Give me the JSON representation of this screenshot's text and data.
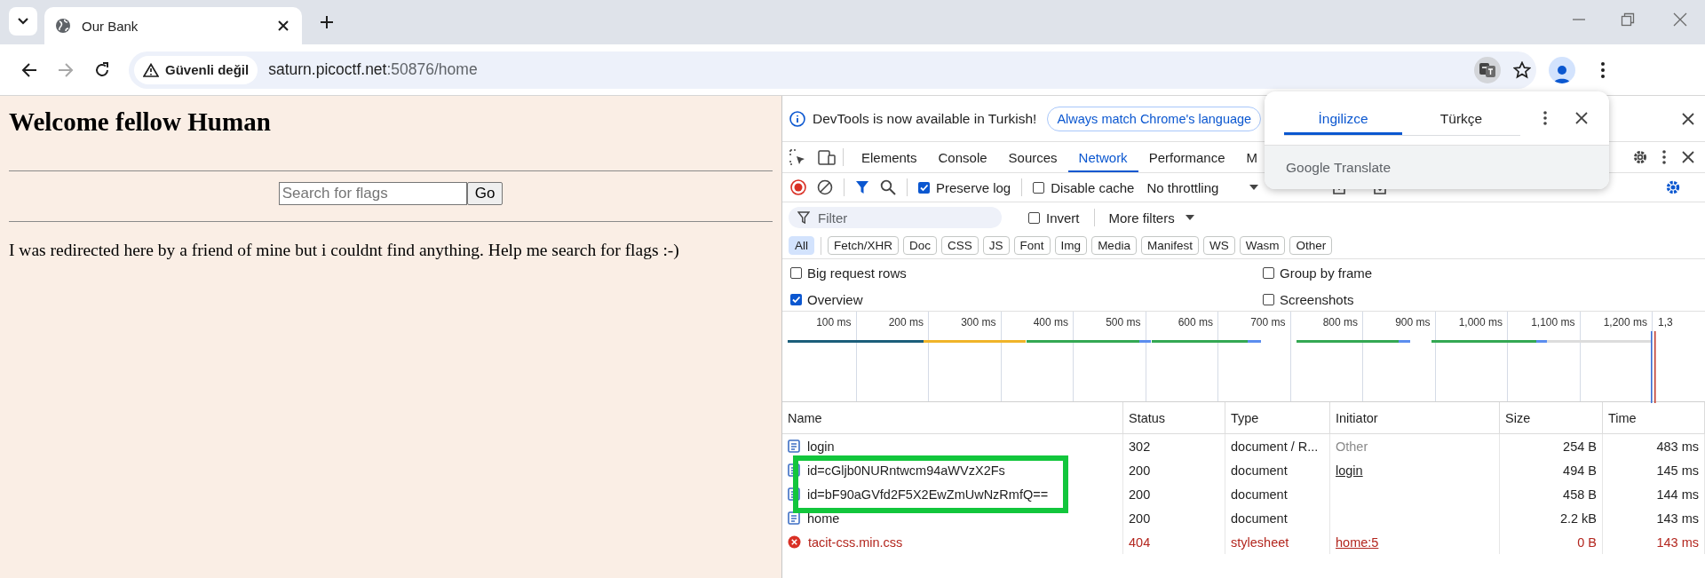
{
  "browser": {
    "tabs": [
      {
        "title": "Our Bank",
        "selected": true
      }
    ],
    "security_label": "Güvenli değil",
    "url_host": "saturn.picoctf.net",
    "url_path": ":50876/home"
  },
  "page": {
    "heading": "Welcome fellow Human",
    "search": {
      "placeholder": "Search for flags"
    },
    "go_button": "Go",
    "paragraph": "I was redirected here by a friend of mine but i couldnt find anything. Help me search for flags :-)"
  },
  "devtools": {
    "notice": {
      "text": "DevTools is now available in Turkish!",
      "button": "Always match Chrome's language"
    },
    "panel_tabs": [
      {
        "label": "Elements",
        "selected": false
      },
      {
        "label": "Console",
        "selected": false
      },
      {
        "label": "Sources",
        "selected": false
      },
      {
        "label": "Network",
        "selected": true
      },
      {
        "label": "Performance",
        "selected": false
      },
      {
        "label": "M",
        "selected": false
      }
    ],
    "toolbar": {
      "preserve_log": {
        "label": "Preserve log",
        "checked": true
      },
      "disable_cache": {
        "label": "Disable cache",
        "checked": false
      },
      "throttling": "No throttling"
    },
    "filter": {
      "placeholder": "Filter"
    },
    "invert": {
      "label": "Invert",
      "checked": false
    },
    "more_filters": "More filters",
    "type_filters": [
      {
        "label": "All",
        "selected": true
      },
      {
        "label": "Fetch/XHR",
        "selected": false
      },
      {
        "label": "Doc",
        "selected": false
      },
      {
        "label": "CSS",
        "selected": false
      },
      {
        "label": "JS",
        "selected": false
      },
      {
        "label": "Font",
        "selected": false
      },
      {
        "label": "Img",
        "selected": false
      },
      {
        "label": "Media",
        "selected": false
      },
      {
        "label": "Manifest",
        "selected": false
      },
      {
        "label": "WS",
        "selected": false
      },
      {
        "label": "Wasm",
        "selected": false
      },
      {
        "label": "Other",
        "selected": false
      }
    ],
    "options": [
      {
        "label": "Big request rows",
        "checked": false
      },
      {
        "label": "Group by frame",
        "checked": false
      },
      {
        "label": "Overview",
        "checked": true
      },
      {
        "label": "Screenshots",
        "checked": false
      }
    ],
    "overview": {
      "ticks": [
        "100 ms",
        "200 ms",
        "300 ms",
        "400 ms",
        "500 ms",
        "600 ms",
        "700 ms",
        "800 ms",
        "900 ms",
        "1,000 ms",
        "1,100 ms",
        "1,200 ms",
        "1,3"
      ]
    },
    "table": {
      "columns": [
        "Name",
        "Status",
        "Type",
        "Initiator",
        "Size",
        "Time"
      ],
      "rows": [
        {
          "name": "login",
          "status": "302",
          "type": "document / R...",
          "initiator": {
            "text": "Other",
            "kind": "muted"
          },
          "size": "254 B",
          "time": "483 ms",
          "failed": false
        },
        {
          "name": "id=cGljb0NURntwcm94aWVzX2Fs",
          "status": "200",
          "type": "document",
          "initiator": {
            "text": "login",
            "kind": "link"
          },
          "size": "494 B",
          "time": "145 ms",
          "failed": false
        },
        {
          "name": "id=bF90aGVfd2F5X2EwZmUwNzRmfQ==",
          "status": "200",
          "type": "document",
          "size": "458 B",
          "time": "144 ms",
          "failed": false
        },
        {
          "name": "home",
          "status": "200",
          "type": "document",
          "size": "2.2 kB",
          "time": "143 ms",
          "failed": false
        },
        {
          "name": "tacit-css.min.css",
          "status": "404",
          "type": "stylesheet",
          "initiator": {
            "text": "home:5",
            "kind": "link"
          },
          "size": "0 B",
          "time": "143 ms",
          "failed": true
        }
      ]
    }
  },
  "translate_popup": {
    "languages": [
      {
        "label": "İngilizce",
        "selected": true
      },
      {
        "label": "Türkçe",
        "selected": false
      }
    ],
    "brand": "Google Translate"
  }
}
